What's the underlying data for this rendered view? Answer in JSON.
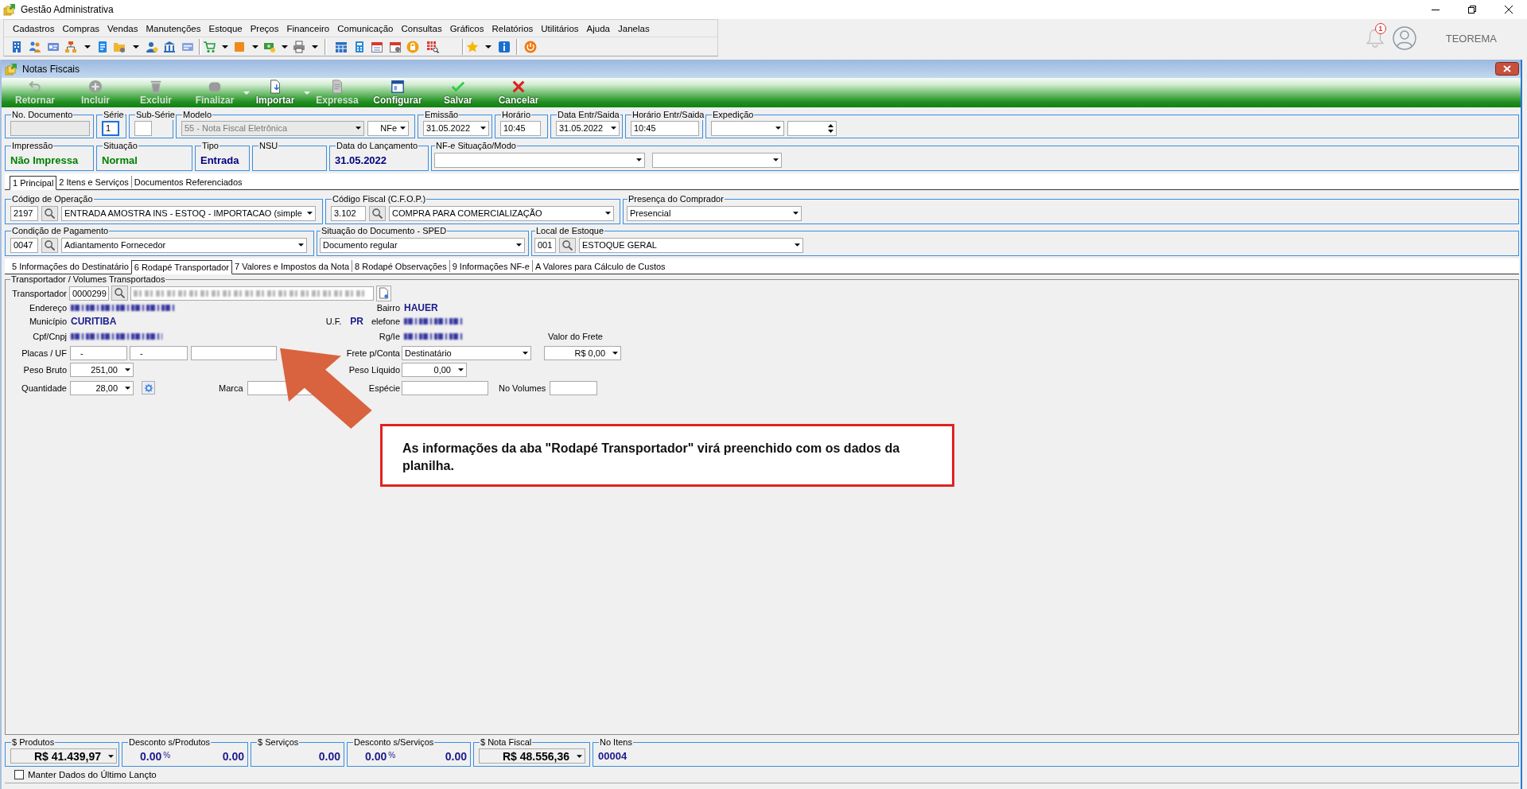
{
  "window": {
    "title": "Gestão Administrativa"
  },
  "menu": [
    "Cadastros",
    "Compras",
    "Vendas",
    "Manutenções",
    "Estoque",
    "Preços",
    "Financeiro",
    "Comunicação",
    "Consultas",
    "Gráficos",
    "Relatórios",
    "Utilitários",
    "Ajuda",
    "Janelas"
  ],
  "user_area": {
    "notifications": "1",
    "user_name": "TEOREMA"
  },
  "child_window": {
    "title": "Notas Fiscais"
  },
  "actions": [
    {
      "label": "Retornar",
      "disabled": true,
      "has_menu": false
    },
    {
      "label": "Incluir",
      "disabled": true,
      "has_menu": false
    },
    {
      "label": "Excluir",
      "disabled": true,
      "has_menu": false
    },
    {
      "label": "Finalizar",
      "disabled": true,
      "has_menu": true
    },
    {
      "label": "Importar",
      "disabled": false,
      "has_menu": true
    },
    {
      "label": "Expressa",
      "disabled": true,
      "has_menu": false
    },
    {
      "label": "Configurar",
      "disabled": false,
      "has_menu": false
    },
    {
      "label": "Salvar",
      "disabled": false,
      "has_menu": false
    },
    {
      "label": "Cancelar",
      "disabled": false,
      "has_menu": false
    }
  ],
  "header_row": [
    {
      "label": "No. Documento",
      "controls": [
        {
          "kind": "input",
          "disabled": true,
          "focused": false
        }
      ]
    },
    {
      "label": "Série",
      "controls": [
        {
          "kind": "input",
          "value": "1",
          "disabled": false,
          "focused": true
        }
      ]
    },
    {
      "label": "Sub-Série",
      "controls": [
        {
          "kind": "input",
          "disabled": false,
          "focused": false
        }
      ]
    },
    {
      "label": "Modelo",
      "controls": [
        {
          "kind": "select",
          "value": "55 - Nota Fiscal Eletrônica",
          "disabled": true,
          "focused": false
        },
        {
          "kind": "select",
          "value": "NFe",
          "disabled": false,
          "focused": false
        }
      ]
    },
    {
      "label": "Emissão",
      "controls": [
        {
          "kind": "select",
          "value": "31.05.2022",
          "disabled": false,
          "focused": false
        }
      ]
    },
    {
      "label": "Horário",
      "controls": [
        {
          "kind": "input",
          "value": "10:45",
          "disabled": false,
          "focused": false
        }
      ]
    },
    {
      "label": "Data Entr/Saida",
      "controls": [
        {
          "kind": "select",
          "value": "31.05.2022",
          "disabled": false,
          "focused": false
        }
      ]
    },
    {
      "label": "Horário Entr/Saida",
      "controls": [
        {
          "kind": "input",
          "value": "10:45",
          "disabled": false,
          "focused": false
        }
      ]
    },
    {
      "label": "Expedição",
      "controls": [
        {
          "kind": "select",
          "disabled": false,
          "focused": false
        },
        {
          "kind": "spin",
          "disabled": false,
          "focused": false
        }
      ]
    }
  ],
  "status_row": [
    {
      "label": "Impressão",
      "value": "Não Impressa",
      "color": "#008000"
    },
    {
      "label": "Situação",
      "value": "Normal",
      "color": "#008000"
    },
    {
      "label": "Tipo",
      "value": "Entrada",
      "color": "#000080"
    },
    {
      "label": "NSU"
    },
    {
      "label": "Data do Lançamento",
      "value": "31.05.2022",
      "color": "#000080"
    },
    {
      "label": "NF-e Situação/Modo",
      "controls": [
        {
          "kind": "select"
        },
        {
          "kind": "select"
        }
      ]
    }
  ],
  "main_tabs": [
    {
      "label": "1 Principal",
      "selected": true
    },
    {
      "label": "2 Itens e Serviços",
      "selected": false
    },
    {
      "label": "Documentos Referenciados",
      "selected": false
    }
  ],
  "operation_row": [
    {
      "label": "Código de Operação",
      "code": "2197",
      "value": "ENTRADA AMOSTRA INS - ESTOQ - IMPORTACAO (simple"
    },
    {
      "label": "Código Fiscal (C.F.O.P.)",
      "code": "3.102",
      "value": "COMPRA PARA COMERCIALIZAÇÃO"
    },
    {
      "label": "Presença do Comprador",
      "value": "Presencial"
    }
  ],
  "payment_row": [
    {
      "label": "Condição de Pagamento",
      "code": "0047",
      "value": "Adiantamento Fornecedor"
    },
    {
      "label": "Situação do Documento - SPED",
      "value": "Documento regular"
    },
    {
      "label": "Local de Estoque",
      "code": "001",
      "value": "ESTOQUE GERAL"
    }
  ],
  "detail_tabs": [
    {
      "label": "5 Informações do Destinatário",
      "selected": false
    },
    {
      "label": "6 Rodapé Transportador",
      "selected": true
    },
    {
      "label": "7 Valores e Impostos da Nota",
      "selected": false
    },
    {
      "label": "8 Rodapé Observações",
      "selected": false
    },
    {
      "label": "9 Informações NF-e",
      "selected": false
    },
    {
      "label": "A Valores para Cálculo de Custos",
      "selected": false
    }
  ],
  "transport": {
    "legend": "Transportador / Volumes Transportados",
    "carrier_label": "Transportador",
    "carrier_code": "0000299",
    "address_label": "Endereço",
    "district_label": "Bairro",
    "district": "HAUER",
    "city_label": "Município",
    "city": "CURITIBA",
    "state_label": "U.F.",
    "state": "PR",
    "phone_label": "elefone",
    "tax_id_label": "Cpf/Cnpj",
    "registration_label": "Rg/Ie",
    "freight_value_label": "Valor do Frete",
    "plates_label": "Placas / UF",
    "plates": [
      "-",
      "-"
    ],
    "freight_account_label": "Frete p/Conta",
    "freight_account": "Destinatário",
    "freight_value": "R$ 0,00",
    "gross_weight_label": "Peso Bruto",
    "gross_weight": "251,00",
    "net_weight_label": "Peso Líquido",
    "net_weight": "0,00",
    "quantity_label": "Quantidade",
    "quantity": "28,00",
    "brand_label": "Marca",
    "species_label": "Espécie",
    "volumes_label": "No Volumes"
  },
  "totals": [
    {
      "label": "$ Produtos",
      "kind": "select",
      "value": "R$ 41.439,97"
    },
    {
      "label": "Desconto s/Produtos",
      "kind": "discount",
      "percent": "0.00",
      "percent_sign": "%",
      "value": "0.00"
    },
    {
      "label": "$ Serviços",
      "kind": "amount",
      "value": "0.00"
    },
    {
      "label": "Desconto s/Serviços",
      "kind": "discount",
      "percent": "0.00",
      "percent_sign": "%",
      "value": "0.00"
    },
    {
      "label": "$ Nota Fiscal",
      "kind": "select",
      "value": "R$ 48.556,36"
    },
    {
      "label": "No Itens",
      "kind": "count",
      "value": "00004"
    }
  ],
  "keep_last_entry": {
    "label": "Manter Dados do Último Lançto",
    "checked": false
  },
  "annotation": {
    "text": "As informações da aba \"Rodapé Transportador\" virá preenchido com os dados da planilha."
  }
}
